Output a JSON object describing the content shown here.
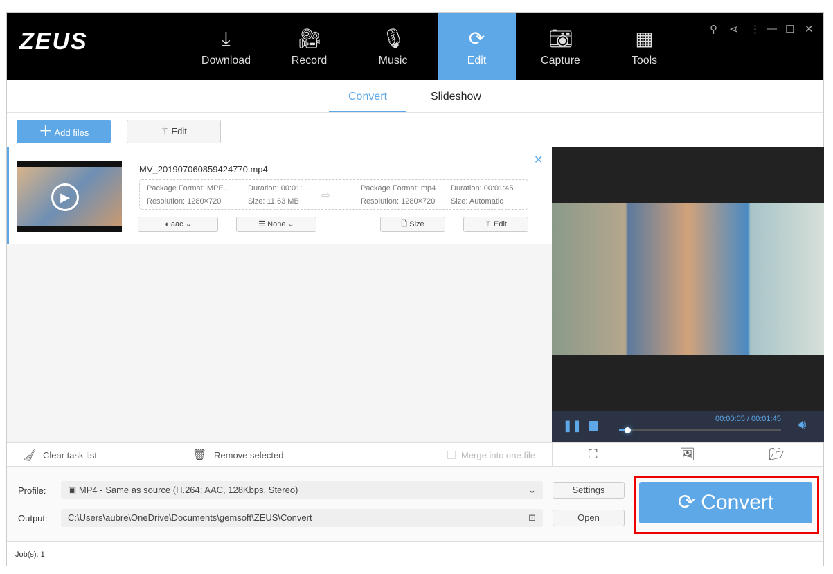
{
  "app": {
    "logo": "ZEUS"
  },
  "nav": [
    {
      "label": "Download",
      "icon": "download-icon"
    },
    {
      "label": "Record",
      "icon": "camera-reel-icon"
    },
    {
      "label": "Music",
      "icon": "microphone-icon"
    },
    {
      "label": "Edit",
      "icon": "convert-icon",
      "active": true
    },
    {
      "label": "Capture",
      "icon": "camera-icon"
    },
    {
      "label": "Tools",
      "icon": "grid-icon"
    }
  ],
  "subtabs": {
    "convert": "Convert",
    "slideshow": "Slideshow"
  },
  "toolbar": {
    "add_files": "Add files",
    "edit": "Edit"
  },
  "file": {
    "name": "MV_201907060859424770.mp4",
    "src_format": "Package Format: MPE...",
    "src_duration": "Duration:  00:01:...",
    "src_resolution": "Resolution: 1280×720",
    "src_size": "Size: 11.63 MB",
    "dst_format": "Package Format: mp4",
    "dst_duration": "Duration: 00:01:45",
    "dst_resolution": "Resolution: 1280×720",
    "dst_size": "Size: Automatic",
    "audio": "aac",
    "subtitle": "None",
    "size_btn": "Size",
    "edit_btn": "Edit"
  },
  "player": {
    "time": "00:00:05 / 00:01:45",
    "progress": 0.05
  },
  "bottom": {
    "clear": "Clear task list",
    "remove": "Remove selected",
    "merge": "Merge into one file"
  },
  "output": {
    "profile_label": "Profile:",
    "profile": "MP4 - Same as source (H.264; AAC, 128Kbps, Stereo)",
    "output_label": "Output:",
    "path": "C:\\Users\\aubre\\OneDrive\\Documents\\gemsoft\\ZEUS\\Convert",
    "settings": "Settings",
    "open": "Open",
    "convert": "Convert"
  },
  "status": {
    "jobs": "Job(s): 1"
  },
  "colors": {
    "accent": "#5ea8e8",
    "highlight": "#e00000"
  }
}
